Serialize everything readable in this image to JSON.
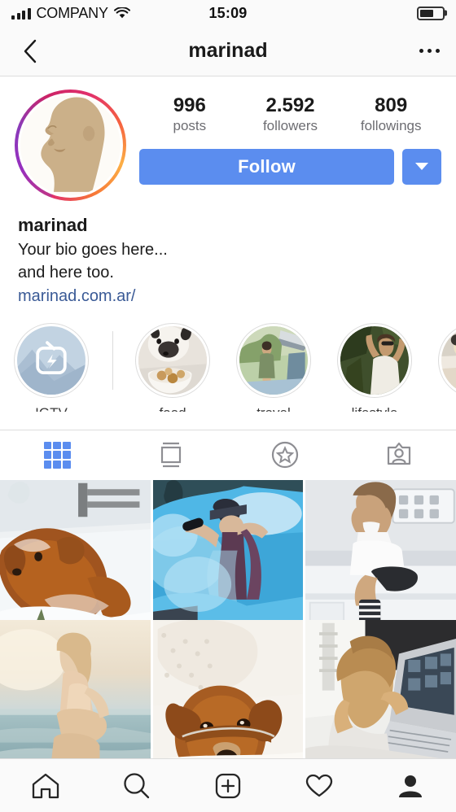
{
  "status_bar": {
    "carrier": "COMPANY",
    "time": "15:09",
    "signal_icon": "signal-bars-icon",
    "wifi_icon": "wifi-icon",
    "battery_icon": "battery-icon",
    "battery_level_pct": 62
  },
  "nav_bar": {
    "back_icon": "chevron-left-icon",
    "title": "marinad",
    "more_icon": "more-options-icon"
  },
  "profile": {
    "avatar_name": "profile-avatar",
    "has_story_ring": true,
    "stats": [
      {
        "value": "996",
        "label": "posts"
      },
      {
        "value": "2.592",
        "label": "followers"
      },
      {
        "value": "809",
        "label": "followings"
      }
    ],
    "follow_button": "Follow",
    "dropdown_icon": "chevron-down-icon",
    "accent_color": "#5b8def",
    "bio": {
      "name": "marinad",
      "lines": [
        "Your bio goes here...",
        "and here too."
      ],
      "link": "marinad.com.ar/",
      "link_color": "#3a5a96"
    }
  },
  "highlights": [
    {
      "label": "IGTV",
      "icon": "igtv-icon",
      "kind": "igtv"
    },
    {
      "label": "food",
      "icon": "highlight-food-cover",
      "kind": "photo"
    },
    {
      "label": "travel",
      "icon": "highlight-travel-cover",
      "kind": "photo"
    },
    {
      "label": "lifestyle",
      "icon": "highlight-lifestyle-cover",
      "kind": "photo"
    },
    {
      "label": "",
      "icon": "highlight-partial-cover",
      "kind": "photo"
    }
  ],
  "content_tabs": [
    {
      "name": "grid",
      "icon": "grid-icon",
      "active": true
    },
    {
      "name": "list",
      "icon": "list-view-icon",
      "active": false
    },
    {
      "name": "saved",
      "icon": "star-circle-icon",
      "active": false
    },
    {
      "name": "tagged",
      "icon": "tagged-person-icon",
      "active": false
    }
  ],
  "photo_grid": [
    {
      "name": "post-dog-in-snow"
    },
    {
      "name": "post-blue-smoke-bomb"
    },
    {
      "name": "post-woman-in-kitchen"
    },
    {
      "name": "post-woman-at-beach"
    },
    {
      "name": "post-dachshund-on-bed"
    },
    {
      "name": "post-woman-with-laptop"
    }
  ],
  "tab_bar": [
    {
      "name": "home",
      "icon": "home-icon",
      "active": false
    },
    {
      "name": "search",
      "icon": "search-icon",
      "active": false
    },
    {
      "name": "add",
      "icon": "add-post-icon",
      "active": false
    },
    {
      "name": "activity",
      "icon": "heart-icon",
      "active": false
    },
    {
      "name": "profile",
      "icon": "profile-person-icon",
      "active": true
    }
  ]
}
